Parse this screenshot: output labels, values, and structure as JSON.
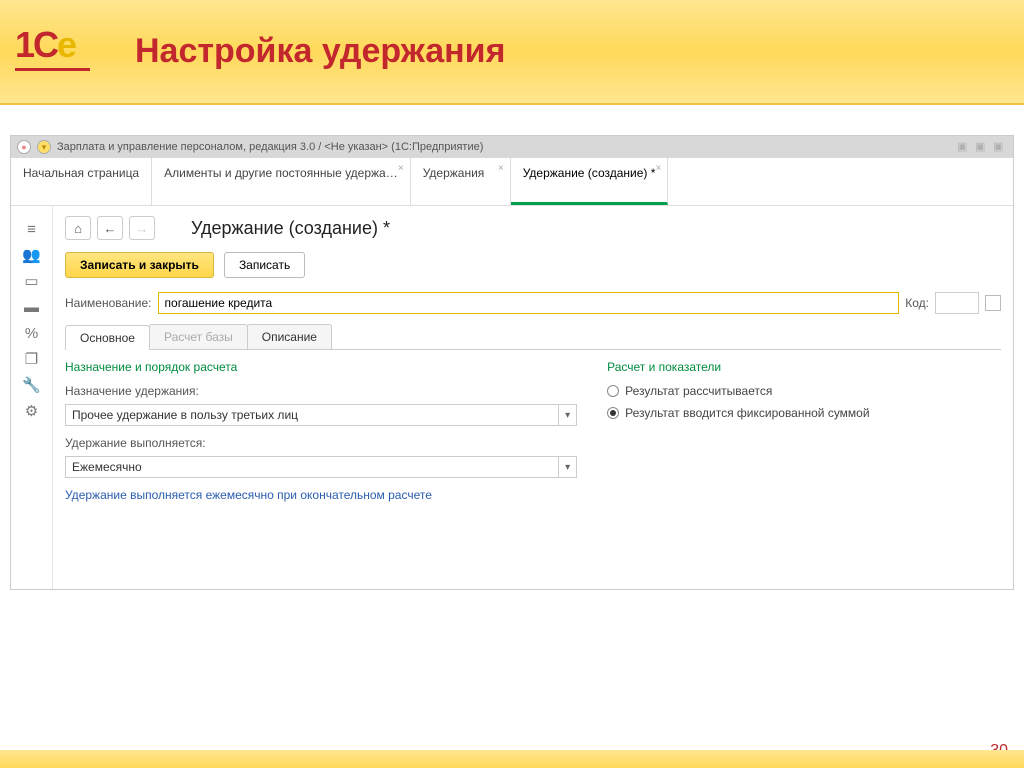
{
  "slide": {
    "title": "Настройка удержания",
    "page_number": "30"
  },
  "app_titlebar": {
    "text": "Зарплата и управление персоналом, редакция 3.0 / <Не указан>  (1С:Предприятие)"
  },
  "top_tabs": [
    {
      "label": "Начальная страница",
      "closable": false
    },
    {
      "label": "Алименты и другие постоянные удержа…",
      "closable": true
    },
    {
      "label": "Удержания",
      "closable": true
    },
    {
      "label": "Удержание (создание) *",
      "closable": true,
      "active": true
    }
  ],
  "page": {
    "title": "Удержание (создание) *",
    "btn_save_close": "Записать и закрыть",
    "btn_save": "Записать",
    "name_label": "Наименование:",
    "name_value": "погашение кредита",
    "code_label": "Код:",
    "code_value": "",
    "inner_tabs": [
      {
        "label": "Основное",
        "active": true
      },
      {
        "label": "Расчет базы",
        "disabled": true
      },
      {
        "label": "Описание"
      }
    ],
    "left": {
      "section": "Назначение и порядок расчета",
      "purpose_label": "Назначение удержания:",
      "purpose_value": "Прочее удержание в пользу третьих лиц",
      "period_label": "Удержание выполняется:",
      "period_value": "Ежемесячно",
      "hint": "Удержание выполняется ежемесячно при окончательном расчете"
    },
    "right": {
      "section": "Расчет и показатели",
      "radio1": "Результат рассчитывается",
      "radio2": "Результат вводится фиксированной суммой",
      "selected": 2
    }
  }
}
